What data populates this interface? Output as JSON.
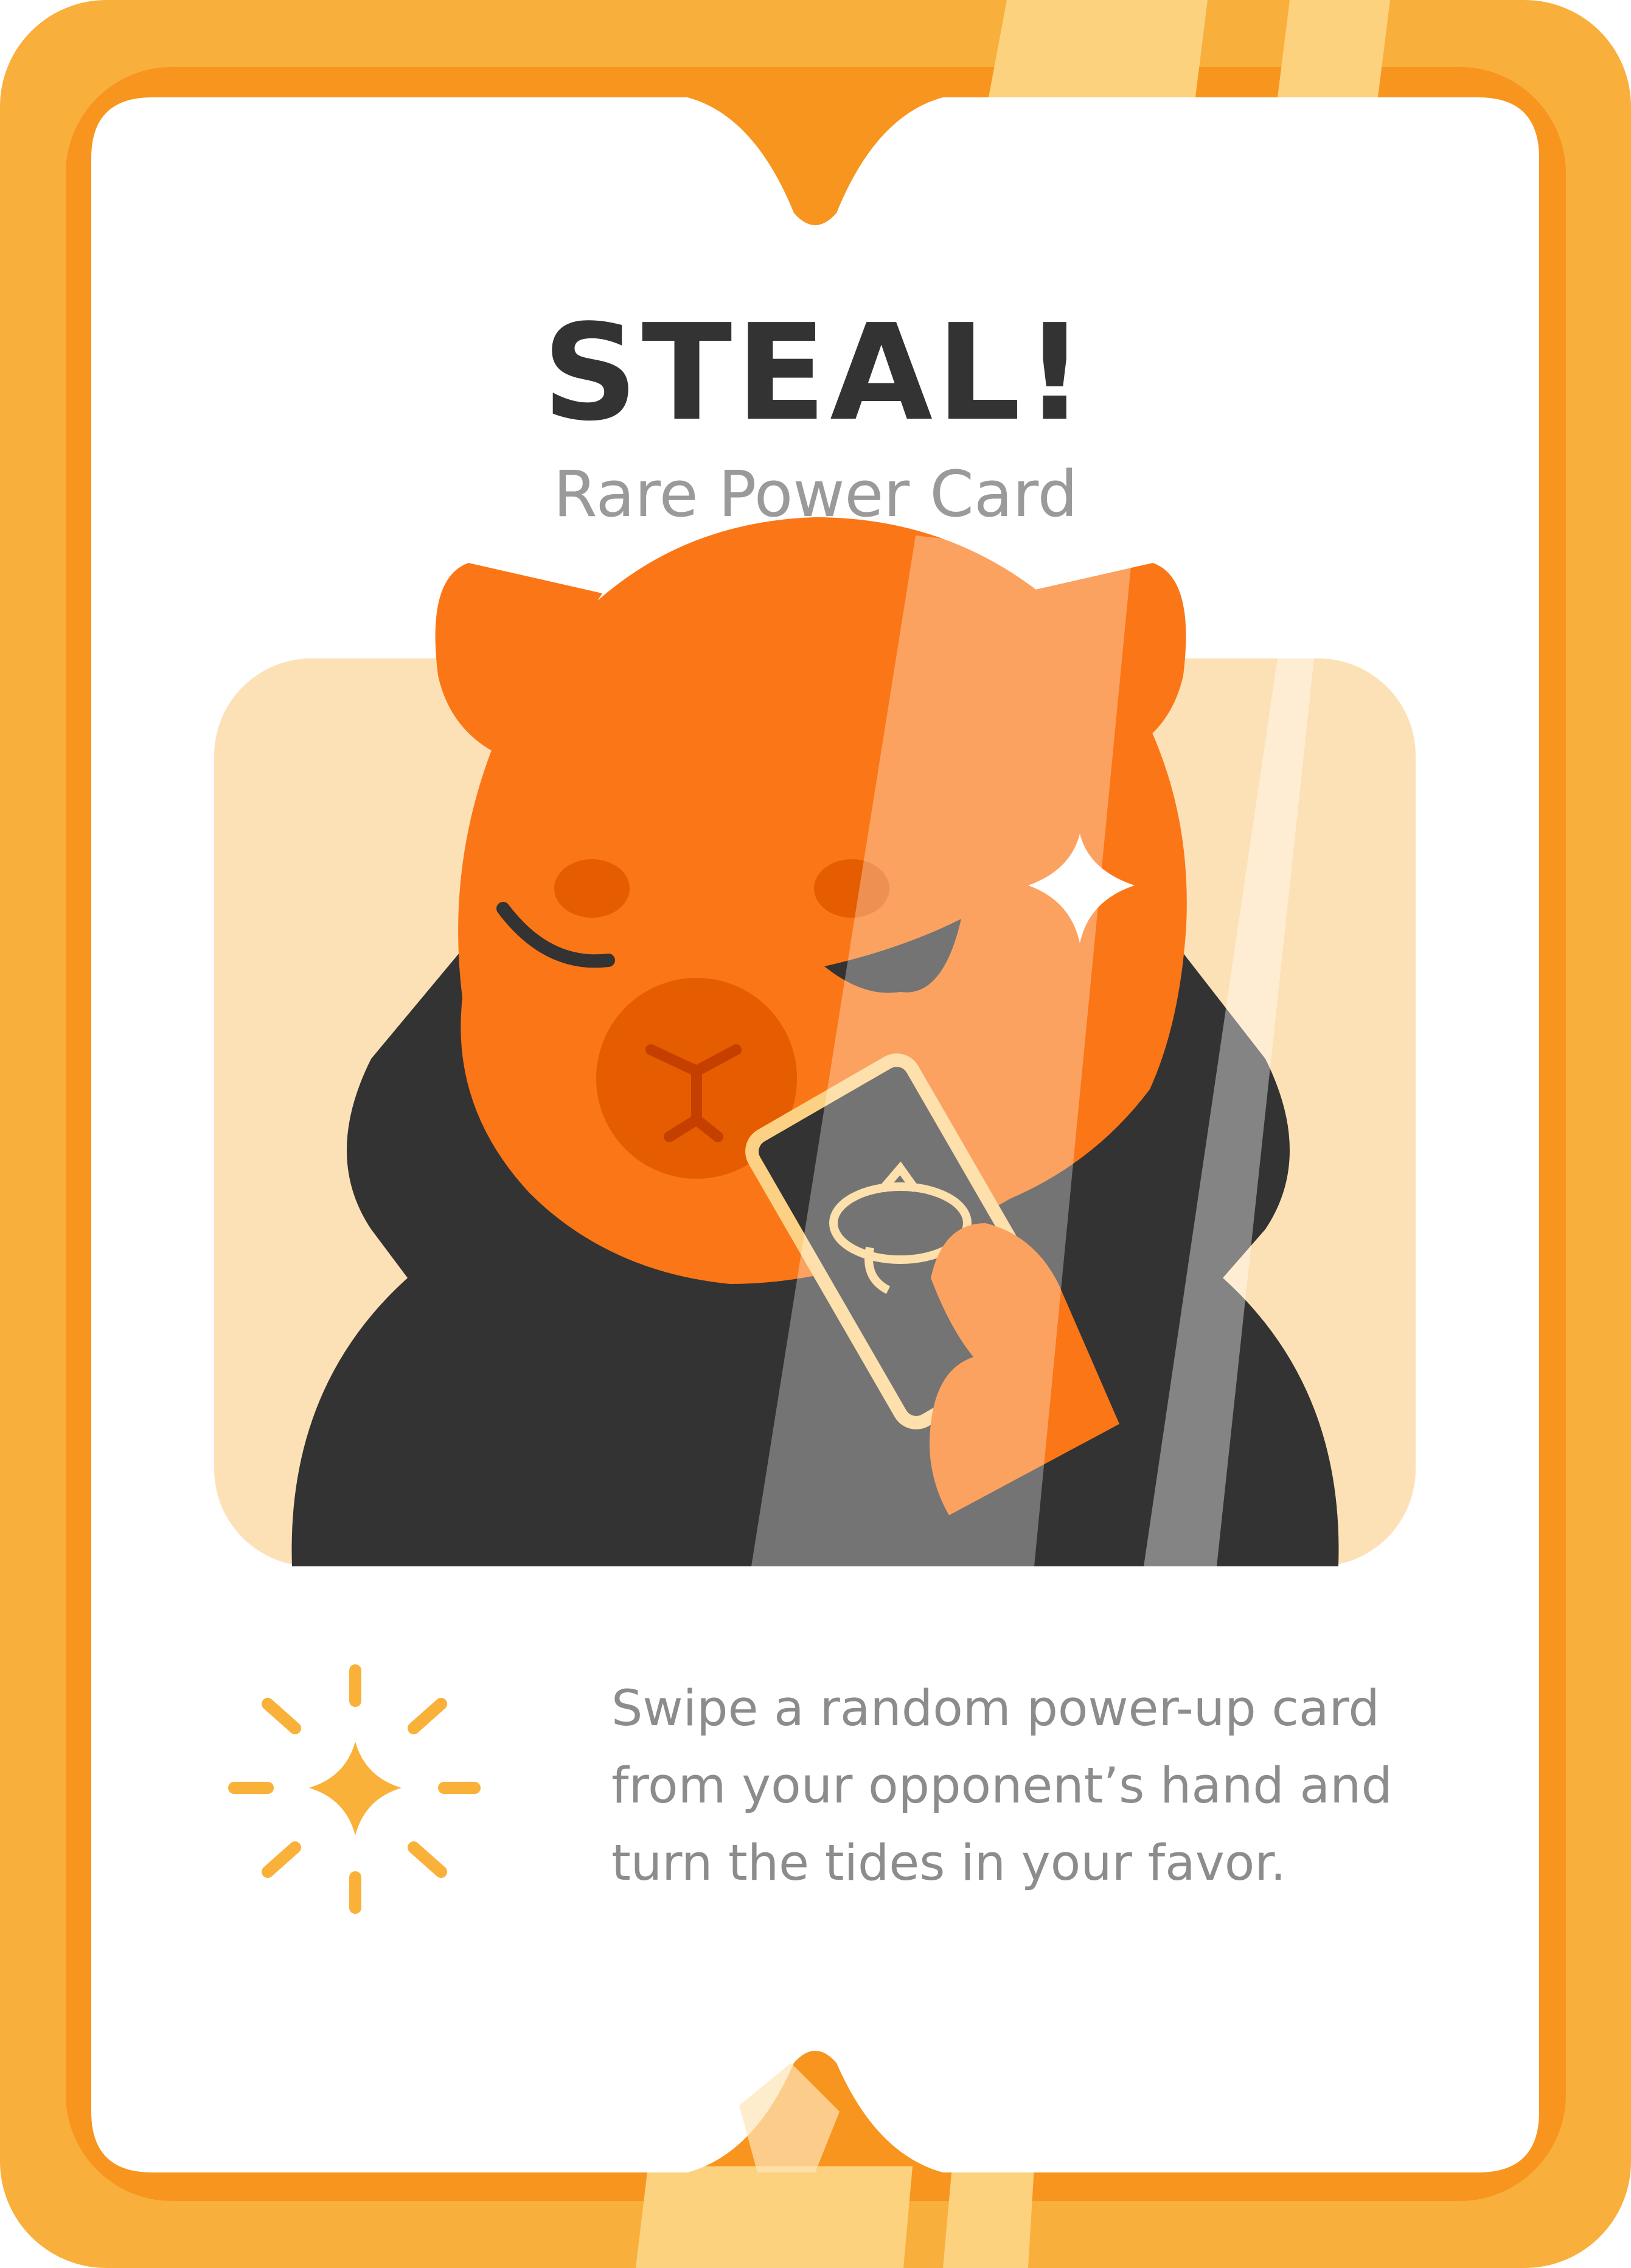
{
  "card": {
    "title": "STEAL!",
    "subtitle": "Rare Power Card",
    "description_lines": [
      "Swipe a random power-up card",
      "from your opponent’s hand and",
      "turn the tides in your favor."
    ]
  },
  "illustration": {
    "character": "bear-holding-card",
    "icons": [
      "sparkle-icon",
      "burst-sparkle-icon"
    ]
  },
  "colors": {
    "frame_outer": "#F9AF3C",
    "frame_inner": "#F7951F",
    "panel_bg": "#FDE1B6",
    "bear_orange": "#FB7617",
    "bear_dark": "#E65C00",
    "hoodie": "#333333",
    "accent_yellow": "#F9B13A",
    "title_text": "#333333",
    "subtitle_text": "#9A9A9A",
    "body_text": "#8C8C8C"
  }
}
